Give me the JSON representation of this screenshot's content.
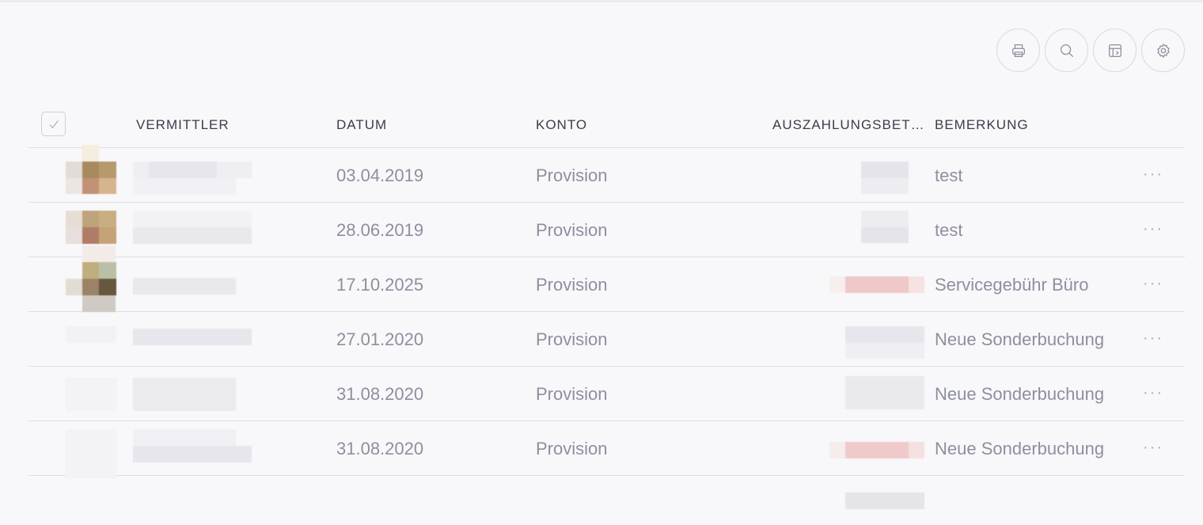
{
  "toolbar": {
    "buttons": [
      {
        "icon": "printer-icon"
      },
      {
        "icon": "search-icon"
      },
      {
        "icon": "table-columns-icon"
      },
      {
        "icon": "gear-icon"
      }
    ]
  },
  "table": {
    "headers": {
      "vermittler": "VERMITTLER",
      "datum": "DATUM",
      "konto": "KONTO",
      "betrag": "AUSZAHLUNGSBET…",
      "bemerkung": "BEMERKUNG"
    },
    "rows": [
      {
        "datum": "03.04.2019",
        "konto": "Provision",
        "bemerkung": "test",
        "more": "···"
      },
      {
        "datum": "28.06.2019",
        "konto": "Provision",
        "bemerkung": "test",
        "more": "···"
      },
      {
        "datum": "17.10.2025",
        "konto": "Provision",
        "bemerkung": "Servicegebühr Büro",
        "more": "···"
      },
      {
        "datum": "27.01.2020",
        "konto": "Provision",
        "bemerkung": "Neue Sonderbuchung",
        "more": "···"
      },
      {
        "datum": "31.08.2020",
        "konto": "Provision",
        "bemerkung": "Neue Sonderbuchung",
        "more": "···"
      },
      {
        "datum": "31.08.2020",
        "konto": "Provision",
        "bemerkung": "Neue Sonderbuchung",
        "more": "···"
      }
    ]
  },
  "colors": {
    "background": "#f8f8fb",
    "header_text": "#3a3d4a",
    "cell_text": "#8d8f9e",
    "negative_amount": "#efc9c9"
  }
}
